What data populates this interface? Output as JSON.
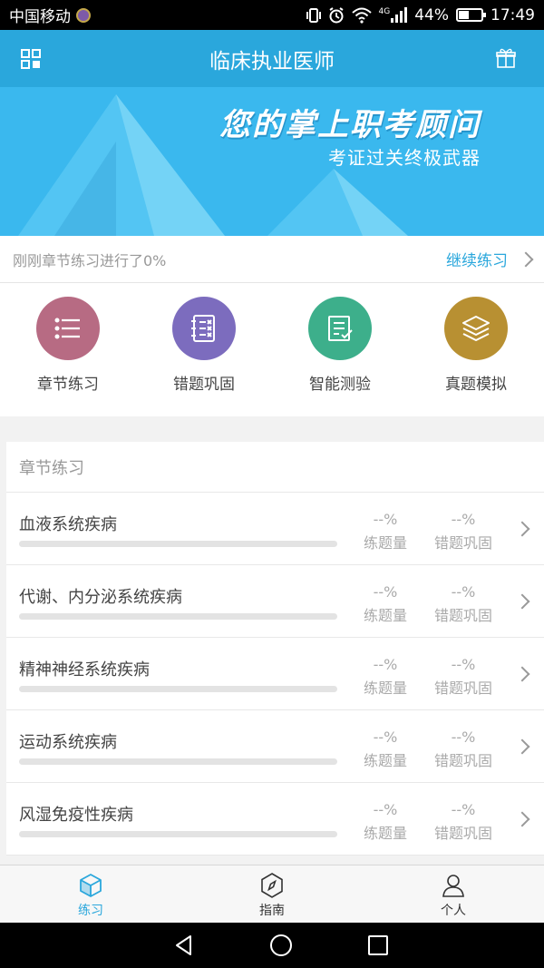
{
  "status_bar": {
    "carrier": "中国移动",
    "network": "4G",
    "battery": "44%",
    "battery_level": 0.44,
    "time": "17:49"
  },
  "header": {
    "title": "临床执业医师",
    "left_icon": "grid-menu-icon",
    "right_icon": "gift-icon"
  },
  "banner": {
    "headline": "您的掌上职考顾问",
    "subline": "考证过关终极武器"
  },
  "progress_notice": {
    "message": "刚刚章节练习进行了0%",
    "action": "继续练习"
  },
  "features": [
    {
      "label": "章节练习",
      "icon": "list-icon",
      "color": "#b76b83"
    },
    {
      "label": "错题巩固",
      "icon": "wrong-notebook-icon",
      "color": "#7c6cbe"
    },
    {
      "label": "智能测验",
      "icon": "checklist-icon",
      "color": "#3daf8b"
    },
    {
      "label": "真题模拟",
      "icon": "layers-icon",
      "color": "#b89032"
    }
  ],
  "chapters": {
    "title": "章节练习",
    "stat_labels": {
      "count": "练题量",
      "review": "错题巩固"
    },
    "rows": [
      {
        "name": "血液系统疾病",
        "count": "--%",
        "review": "--%",
        "progress": 0
      },
      {
        "name": "代谢、内分泌系统疾病",
        "count": "--%",
        "review": "--%",
        "progress": 0
      },
      {
        "name": "精神神经系统疾病",
        "count": "--%",
        "review": "--%",
        "progress": 0
      },
      {
        "name": "运动系统疾病",
        "count": "--%",
        "review": "--%",
        "progress": 0
      },
      {
        "name": "风湿免疫性疾病",
        "count": "--%",
        "review": "--%",
        "progress": 0
      }
    ]
  },
  "tabs": [
    {
      "label": "练习",
      "icon": "cube-icon",
      "active": true
    },
    {
      "label": "指南",
      "icon": "compass-icon",
      "active": false
    },
    {
      "label": "个人",
      "icon": "person-icon",
      "active": false
    }
  ],
  "accent_color": "#2aa7dc"
}
